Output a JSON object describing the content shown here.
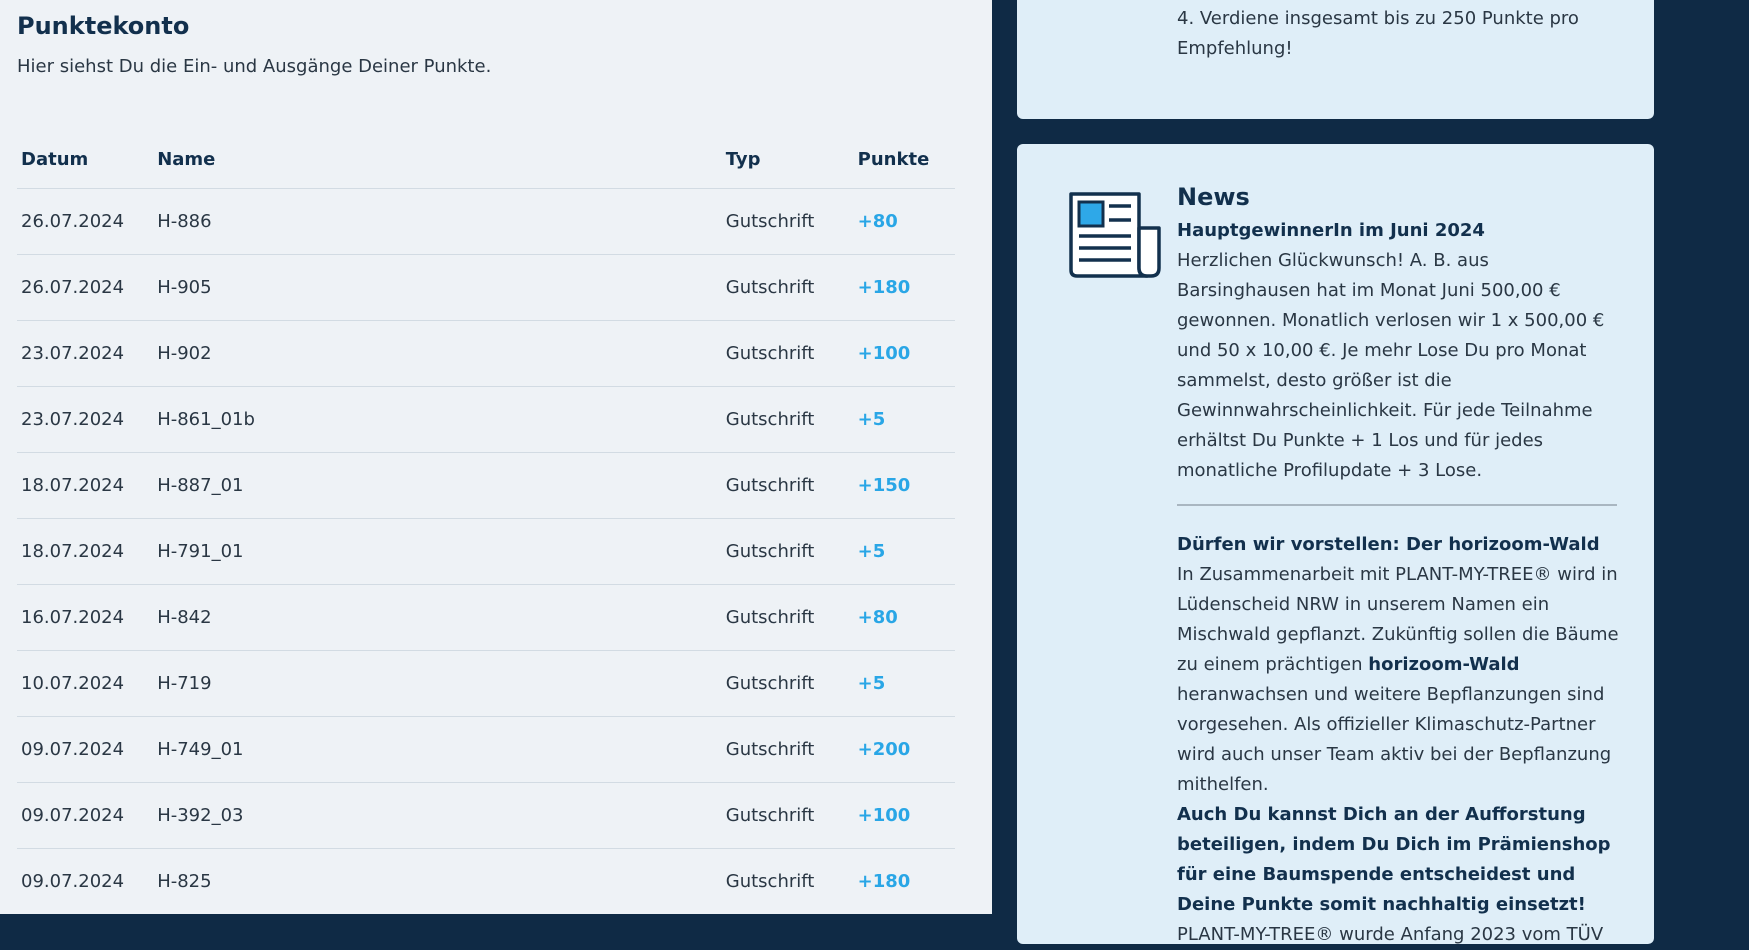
{
  "page": {
    "title": "Punktekonto",
    "subtitle": "Hier siehst Du die Ein- und Ausgänge Deiner Punkte."
  },
  "table": {
    "headers": [
      "Datum",
      "Name",
      "Typ",
      "Punkte"
    ],
    "rows": [
      [
        "26.07.2024",
        "H-886",
        "Gutschrift",
        "+80"
      ],
      [
        "26.07.2024",
        "H-905",
        "Gutschrift",
        "+180"
      ],
      [
        "23.07.2024",
        "H-902",
        "Gutschrift",
        "+100"
      ],
      [
        "23.07.2024",
        "H-861_01b",
        "Gutschrift",
        "+5"
      ],
      [
        "18.07.2024",
        "H-887_01",
        "Gutschrift",
        "+150"
      ],
      [
        "18.07.2024",
        "H-791_01",
        "Gutschrift",
        "+5"
      ],
      [
        "16.07.2024",
        "H-842",
        "Gutschrift",
        "+80"
      ],
      [
        "10.07.2024",
        "H-719",
        "Gutschrift",
        "+5"
      ],
      [
        "09.07.2024",
        "H-749_01",
        "Gutschrift",
        "+200"
      ],
      [
        "09.07.2024",
        "H-392_03",
        "Gutschrift",
        "+100"
      ],
      [
        "09.07.2024",
        "H-825",
        "Gutschrift",
        "+180"
      ]
    ]
  },
  "referral": {
    "step4": "4. Verdiene insgesamt bis zu 250 Punkte pro Empfehlung!"
  },
  "news": {
    "title": "News",
    "icon": "newspaper-icon",
    "item1": {
      "title": "HauptgewinnerIn im Juni 2024",
      "text": "Herzlichen Glückwunsch! A. B. aus Barsinghausen hat im Monat Juni 500,00 € gewonnen. Monatlich verlosen wir 1 x 500,00 € und 50 x 10,00 €. Je mehr Lose Du pro Monat sammelst, desto größer ist die Gewinnwahrscheinlichkeit. Für jede Teilnahme erhältst Du Punkte + 1 Los und für jedes monatliche Profilupdate + 3 Lose."
    },
    "item2": {
      "title": "Dürfen wir vorstellen: Der horizoom-Wald",
      "text_before": "In Zusammenarbeit mit PLANT-MY-TREE® wird in Lüdenscheid NRW in unserem Namen ein Mischwald gepflanzt. Zukünftig sollen die Bäume zu einem prächtigen",
      "text_bold": "horizoom-Wald",
      "text_after": "heranwachsen und weitere Bepflanzungen sind vorgesehen. Als offizieller Klimaschutz-Partner wird auch unser Team aktiv bei der Bepflanzung mithelfen.",
      "call_to_action": "Auch Du kannst Dich an der Aufforstung beteiligen, indem Du Dich im Prämienshop für eine Baumspende entscheidest und Deine Punkte somit nachhaltig einsetzt!",
      "text_cut": "PLANT-MY-TREE® wurde Anfang 2023 vom TÜV"
    }
  },
  "colors": {
    "accent": "#29a6e6",
    "sidebar_bg": "#0f2a45",
    "card_bg": "#dfeef8",
    "main_bg": "#eef2f6"
  }
}
